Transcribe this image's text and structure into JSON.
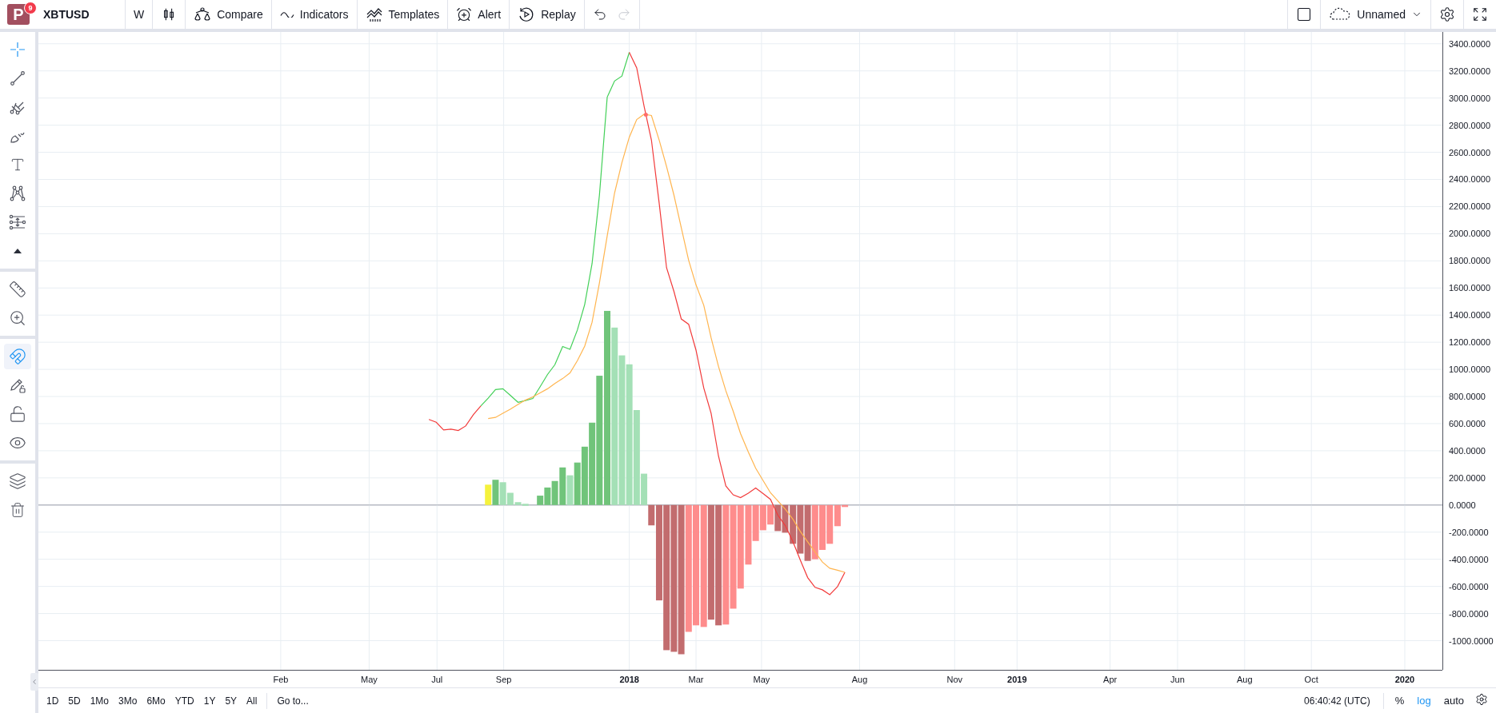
{
  "toolbar": {
    "logo": {
      "letter": "P",
      "badge": "9"
    },
    "symbol": "XBTUSD",
    "interval": "W",
    "buttons": [
      {
        "kind": "compare",
        "label": "Compare"
      },
      {
        "kind": "indicators",
        "label": "Indicators"
      },
      {
        "kind": "templates",
        "label": "Templates"
      },
      {
        "kind": "alert",
        "label": "Alert"
      },
      {
        "kind": "replay",
        "label": "Replay"
      }
    ],
    "undo": {
      "disabled": false
    },
    "redo": {
      "disabled": true
    },
    "layout": {
      "name": "Unnamed"
    }
  },
  "left_toolbar": {
    "groups": [
      {
        "tools": [
          {
            "kind": "crosshair",
            "selected": true
          },
          {
            "kind": "trend-line",
            "selected": false
          },
          {
            "kind": "pitchfork",
            "selected": false
          },
          {
            "kind": "brush",
            "selected": false
          },
          {
            "kind": "text",
            "selected": false
          },
          {
            "kind": "pattern",
            "selected": false
          },
          {
            "kind": "measure",
            "selected": false
          },
          {
            "kind": "more",
            "selected": false
          }
        ]
      },
      {
        "tools": [
          {
            "kind": "ruler",
            "selected": false
          },
          {
            "kind": "zoom",
            "selected": false
          }
        ]
      },
      {
        "tools": [
          {
            "kind": "magnet",
            "selected": true
          },
          {
            "kind": "pencil-lock",
            "selected": false
          },
          {
            "kind": "lock",
            "selected": false
          },
          {
            "kind": "eye",
            "selected": false
          }
        ]
      },
      {
        "tools": [
          {
            "kind": "layers",
            "selected": false
          },
          {
            "kind": "trash",
            "selected": false
          }
        ]
      }
    ]
  },
  "chart": {
    "chart_data": {
      "type": "bar",
      "x": [
        2017.483,
        2017.502,
        2017.521,
        2017.54,
        2017.559,
        2017.578,
        2017.598,
        2017.617,
        2017.636,
        2017.655,
        2017.674,
        2017.693,
        2017.713,
        2017.732,
        2017.751,
        2017.77,
        2017.789,
        2017.808,
        2017.828,
        2017.847,
        2017.866,
        2017.885,
        2017.904,
        2017.923,
        2017.943,
        2017.962,
        2017.981,
        2018,
        2018.019,
        2018.038,
        2018.057,
        2018.077,
        2018.096,
        2018.115,
        2018.134,
        2018.153,
        2018.172,
        2018.192,
        2018.211,
        2018.23,
        2018.249,
        2018.268,
        2018.287,
        2018.307,
        2018.326,
        2018.345,
        2018.364,
        2018.383,
        2018.402,
        2018.422,
        2018.441,
        2018.46,
        2018.479,
        2018.498,
        2018.517,
        2018.537,
        2018.556
      ],
      "series": [
        {
          "type": "bar",
          "color": "#f5f23c",
          "values": [
            null,
            null,
            null,
            null,
            null,
            null,
            null,
            null,
            150,
            null,
            null,
            null,
            null,
            null,
            null,
            null,
            null,
            null,
            null,
            null,
            null,
            null,
            null,
            null,
            null,
            null,
            null,
            null,
            null,
            null,
            null,
            null,
            null,
            null,
            null,
            null,
            null,
            null,
            null,
            null,
            null,
            null,
            null,
            null,
            null,
            null,
            null,
            null,
            null,
            null,
            null,
            null,
            null,
            null,
            null,
            null,
            null
          ]
        },
        {
          "type": "bar",
          "color": "#70c47a",
          "values": [
            null,
            null,
            null,
            null,
            null,
            null,
            null,
            null,
            null,
            186,
            null,
            null,
            null,
            null,
            null,
            69,
            129,
            177,
            277,
            null,
            313,
            430,
            607,
            953,
            1431,
            null,
            null,
            null,
            null,
            null,
            null,
            null,
            null,
            null,
            null,
            null,
            null,
            null,
            null,
            null,
            null,
            null,
            null,
            null,
            null,
            null,
            null,
            null,
            null,
            null,
            null,
            null,
            null,
            null,
            null,
            null,
            null
          ]
        },
        {
          "type": "bar",
          "color": "#a4e0b6",
          "values": [
            null,
            null,
            null,
            null,
            null,
            null,
            null,
            null,
            null,
            null,
            168,
            90,
            21,
            9,
            null,
            null,
            null,
            null,
            null,
            219,
            null,
            null,
            null,
            null,
            null,
            1308,
            1103,
            1037,
            700,
            231,
            null,
            null,
            null,
            null,
            null,
            null,
            null,
            null,
            null,
            null,
            null,
            null,
            null,
            null,
            null,
            null,
            null,
            null,
            null,
            null,
            null,
            null,
            null,
            null,
            null,
            null,
            null
          ]
        },
        {
          "type": "bar",
          "color": "#c26c6e",
          "values": [
            null,
            null,
            null,
            null,
            null,
            null,
            null,
            null,
            null,
            null,
            null,
            null,
            null,
            null,
            null,
            null,
            null,
            null,
            null,
            null,
            null,
            null,
            null,
            null,
            null,
            null,
            null,
            null,
            null,
            null,
            -150,
            -703,
            -1070,
            -1082,
            -1100,
            null,
            null,
            null,
            -845,
            -887,
            null,
            null,
            null,
            null,
            null,
            null,
            null,
            -192,
            -204,
            -286,
            -358,
            -412,
            null,
            null,
            null,
            null,
            null
          ]
        },
        {
          "type": "bar",
          "color": "#fe8c8c",
          "values": [
            null,
            null,
            null,
            null,
            null,
            null,
            null,
            null,
            null,
            null,
            null,
            null,
            null,
            null,
            null,
            null,
            null,
            null,
            null,
            null,
            null,
            null,
            null,
            null,
            null,
            null,
            null,
            null,
            null,
            null,
            null,
            null,
            null,
            null,
            null,
            -935,
            -887,
            -899,
            null,
            null,
            -881,
            -764,
            -616,
            -439,
            -265,
            -186,
            -144,
            null,
            null,
            null,
            null,
            null,
            -400,
            -331,
            -286,
            -156,
            -9
          ]
        },
        {
          "type": "line",
          "color": "#43d058",
          "values": [
            null,
            null,
            null,
            null,
            null,
            null,
            null,
            730,
            788,
            851,
            857,
            809,
            757,
            770,
            785,
            872,
            962,
            1034,
            1169,
            1148,
            1290,
            1479,
            1780,
            2285,
            3006,
            3126,
            3162,
            3337,
            null,
            null,
            null,
            null,
            null,
            null,
            null,
            null,
            null,
            null,
            null,
            null,
            null,
            null,
            null,
            null,
            null,
            null,
            null,
            null,
            null,
            null,
            null,
            null,
            null,
            null,
            null,
            null,
            null
          ]
        },
        {
          "type": "line",
          "color": "#f23b3b",
          "values": [
            631,
            610,
            553,
            559,
            550,
            583,
            667,
            730,
            null,
            null,
            null,
            null,
            null,
            null,
            null,
            null,
            null,
            null,
            null,
            null,
            null,
            null,
            null,
            null,
            null,
            null,
            null,
            3337,
            3222,
            2940,
            2690,
            2224,
            1749,
            1575,
            1371,
            1332,
            1142,
            863,
            676,
            361,
            141,
            75,
            54,
            87,
            126,
            84,
            42,
            -75,
            -150,
            -271,
            -406,
            -535,
            -607,
            -625,
            -661,
            -601,
            -496
          ]
        },
        {
          "type": "line",
          "color": "#ffb54f",
          "values": [
            null,
            null,
            null,
            null,
            null,
            null,
            null,
            null,
            637,
            646,
            676,
            706,
            742,
            773,
            797,
            827,
            857,
            896,
            932,
            974,
            1064,
            1172,
            1347,
            1638,
            1984,
            2300,
            2525,
            2711,
            2841,
            2880,
            2871,
            2690,
            2495,
            2285,
            2044,
            1804,
            1623,
            1473,
            1232,
            1022,
            842,
            691,
            526,
            391,
            271,
            180,
            90,
            30,
            -30,
            -105,
            -195,
            -271,
            -346,
            -421,
            -466,
            -480,
            -496
          ]
        }
      ],
      "xlim": [
        2016.476,
        2020.097
      ],
      "ylim": [
        -1215,
        3487
      ],
      "xticks": [
        {
          "value": 2017.101,
          "label": "Feb"
        },
        {
          "value": 2017.329,
          "label": "May"
        },
        {
          "value": 2017.504,
          "label": "Jul"
        },
        {
          "value": 2017.676,
          "label": "Sep"
        },
        {
          "value": 2018,
          "label": "2018"
        },
        {
          "value": 2018.172,
          "label": "Mar"
        },
        {
          "value": 2018.341,
          "label": "May"
        },
        {
          "value": 2018.594,
          "label": "Aug"
        },
        {
          "value": 2018.839,
          "label": "Nov"
        },
        {
          "value": 2019,
          "label": "2019"
        },
        {
          "value": 2019.24,
          "label": "Apr"
        },
        {
          "value": 2019.414,
          "label": "Jun"
        },
        {
          "value": 2019.587,
          "label": "Aug"
        },
        {
          "value": 2019.759,
          "label": "Oct"
        },
        {
          "value": 2020,
          "label": "2020"
        }
      ],
      "yticks": [
        {
          "value": 3400,
          "label": "3400.0000"
        },
        {
          "value": 3200,
          "label": "3200.0000"
        },
        {
          "value": 3000,
          "label": "3000.0000"
        },
        {
          "value": 2800,
          "label": "2800.0000"
        },
        {
          "value": 2600,
          "label": "2600.0000"
        },
        {
          "value": 2400,
          "label": "2400.0000"
        },
        {
          "value": 2200,
          "label": "2200.0000"
        },
        {
          "value": 2000,
          "label": "2000.0000"
        },
        {
          "value": 1800,
          "label": "1800.0000"
        },
        {
          "value": 1600,
          "label": "1600.0000"
        },
        {
          "value": 1400,
          "label": "1400.0000"
        },
        {
          "value": 1200,
          "label": "1200.0000"
        },
        {
          "value": 1000,
          "label": "1000.0000"
        },
        {
          "value": 800,
          "label": "800.0000"
        },
        {
          "value": 600,
          "label": "600.0000"
        },
        {
          "value": 400,
          "label": "400.0000"
        },
        {
          "value": 200,
          "label": "200.0000"
        },
        {
          "value": 0,
          "label": "0.0000"
        },
        {
          "value": -200,
          "label": "-200.0000"
        },
        {
          "value": -400,
          "label": "-400.0000"
        },
        {
          "value": -600,
          "label": "-600.0000"
        },
        {
          "value": -800,
          "label": "-800.0000"
        },
        {
          "value": -1000,
          "label": "-1000.0000"
        }
      ],
      "grid": true
    }
  },
  "bottom_bar": {
    "ranges": [
      "1D",
      "5D",
      "1Mo",
      "3Mo",
      "6Mo",
      "YTD",
      "1Y",
      "5Y",
      "All"
    ],
    "goto": "Go to...",
    "clock": "06:40:42 (UTC)",
    "toggles": [
      {
        "label": "%",
        "selected": false
      },
      {
        "label": "log",
        "selected": true
      },
      {
        "label": "auto",
        "selected": false
      }
    ]
  }
}
